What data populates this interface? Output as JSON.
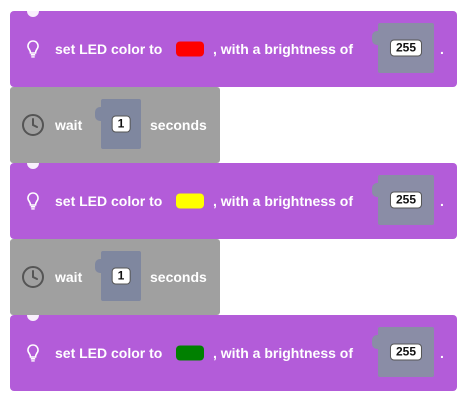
{
  "blocks": [
    {
      "type": "led",
      "icon": "lightbulb-icon",
      "label_prefix": "set LED color to",
      "color": "#ff0000",
      "label_mid": ", with a brightness of",
      "brightness": "255",
      "suffix": "."
    },
    {
      "type": "wait",
      "icon": "clock-icon",
      "label_prefix": "wait",
      "value": "1",
      "label_suffix": "seconds"
    },
    {
      "type": "led",
      "icon": "lightbulb-icon",
      "label_prefix": "set LED color to",
      "color": "#ffff00",
      "label_mid": ", with a brightness of",
      "brightness": "255",
      "suffix": "."
    },
    {
      "type": "wait",
      "icon": "clock-icon",
      "label_prefix": "wait",
      "value": "1",
      "label_suffix": "seconds"
    },
    {
      "type": "led",
      "icon": "lightbulb-icon",
      "label_prefix": "set LED color to",
      "color": "#008000",
      "label_mid": ", with a brightness of",
      "brightness": "255",
      "suffix": "."
    }
  ],
  "colors": {
    "led_block": "#b35cd9",
    "wait_block": "#a0a0a0",
    "slot": "#8a8da6"
  }
}
